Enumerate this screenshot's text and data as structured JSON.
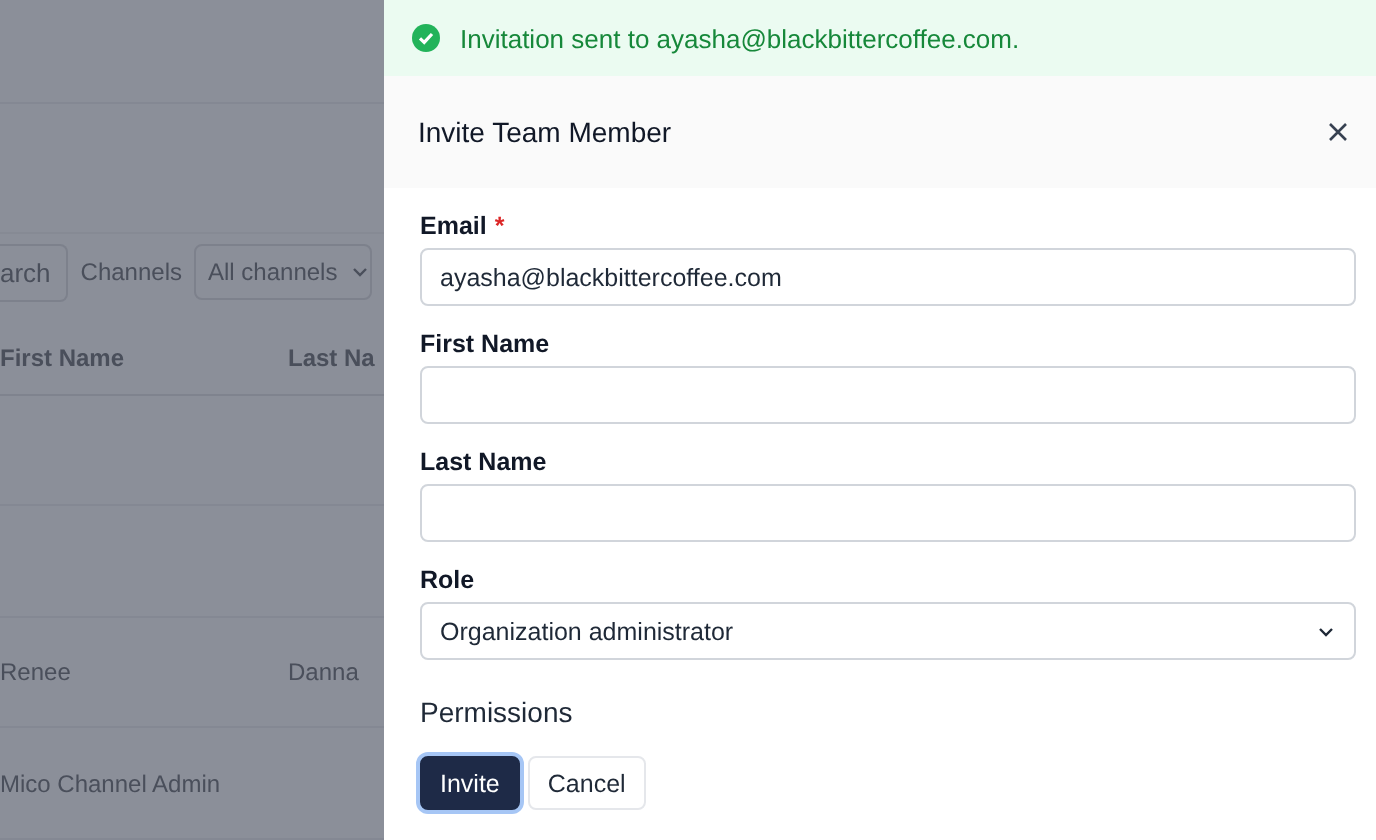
{
  "background_page": {
    "search_button": "arch",
    "channels_label": "Channels",
    "channels_select": "All channels",
    "table": {
      "columns": [
        "First Name",
        "Last Na"
      ],
      "rows": [
        {},
        {},
        {
          "first_name": "Renee",
          "last_name": "Danna"
        },
        {
          "first_name": "Mico Channel Admin"
        }
      ]
    }
  },
  "toast": {
    "kind": "success",
    "text": "Invitation sent to ayasha@blackbittercoffee.com."
  },
  "modal": {
    "title": "Invite Team Member",
    "fields": [
      {
        "kind": "text",
        "label": "Email",
        "required_mark": "*",
        "value": "ayasha@blackbittercoffee.com"
      },
      {
        "kind": "text",
        "label": "First Name"
      },
      {
        "kind": "text",
        "label": "Last Name"
      },
      {
        "kind": "select",
        "label": "Role",
        "value": "Organization administrator"
      }
    ],
    "permissions_heading": "Permissions",
    "buttons": [
      {
        "kind": "primary",
        "label": "Invite",
        "focused": true
      },
      {
        "kind": "secondary",
        "label": "Cancel",
        "focused": false
      }
    ]
  }
}
